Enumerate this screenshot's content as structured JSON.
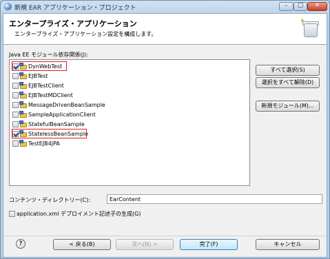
{
  "window": {
    "title": "新規 EAR アプリケーション・プロジェクト"
  },
  "header": {
    "title": "エンタープライズ・アプリケーション",
    "description": "エンタープライズ・アプリケーション設定を構成します。"
  },
  "modules": {
    "label": "Java EE モジュール依存関係(J):",
    "items": [
      {
        "label": "DynWebTest",
        "checked": true
      },
      {
        "label": "EJBTest",
        "checked": false
      },
      {
        "label": "EJBTestClient",
        "checked": false
      },
      {
        "label": "EJBTestMDClient",
        "checked": false
      },
      {
        "label": "MessageDrivenBeanSample",
        "checked": false
      },
      {
        "label": "SampleApplicationClient",
        "checked": false
      },
      {
        "label": "StatefulBeanSample",
        "checked": false
      },
      {
        "label": "StatelessBeanSample",
        "checked": true
      },
      {
        "label": "TestEJB4JPA",
        "checked": false
      }
    ]
  },
  "side_buttons": {
    "select_all": "すべて選択(S)",
    "deselect_all": "選択をすべて解除(D)",
    "new_module": "新規モジュール(M)..."
  },
  "content_dir": {
    "label": "コンテンツ・ディレクトリー(C):",
    "value": "EarContent"
  },
  "generate_descriptor": {
    "label": "application.xml デプロイメント記述子の生成(G)",
    "checked": false
  },
  "footer": {
    "help": "?",
    "back": "< 戻る(B)",
    "next": "次へ(N) >",
    "finish": "完了(F)",
    "cancel": "キャンセル"
  },
  "colors": {
    "highlight": "#e11d1d",
    "accent": "#3c7fb1"
  }
}
